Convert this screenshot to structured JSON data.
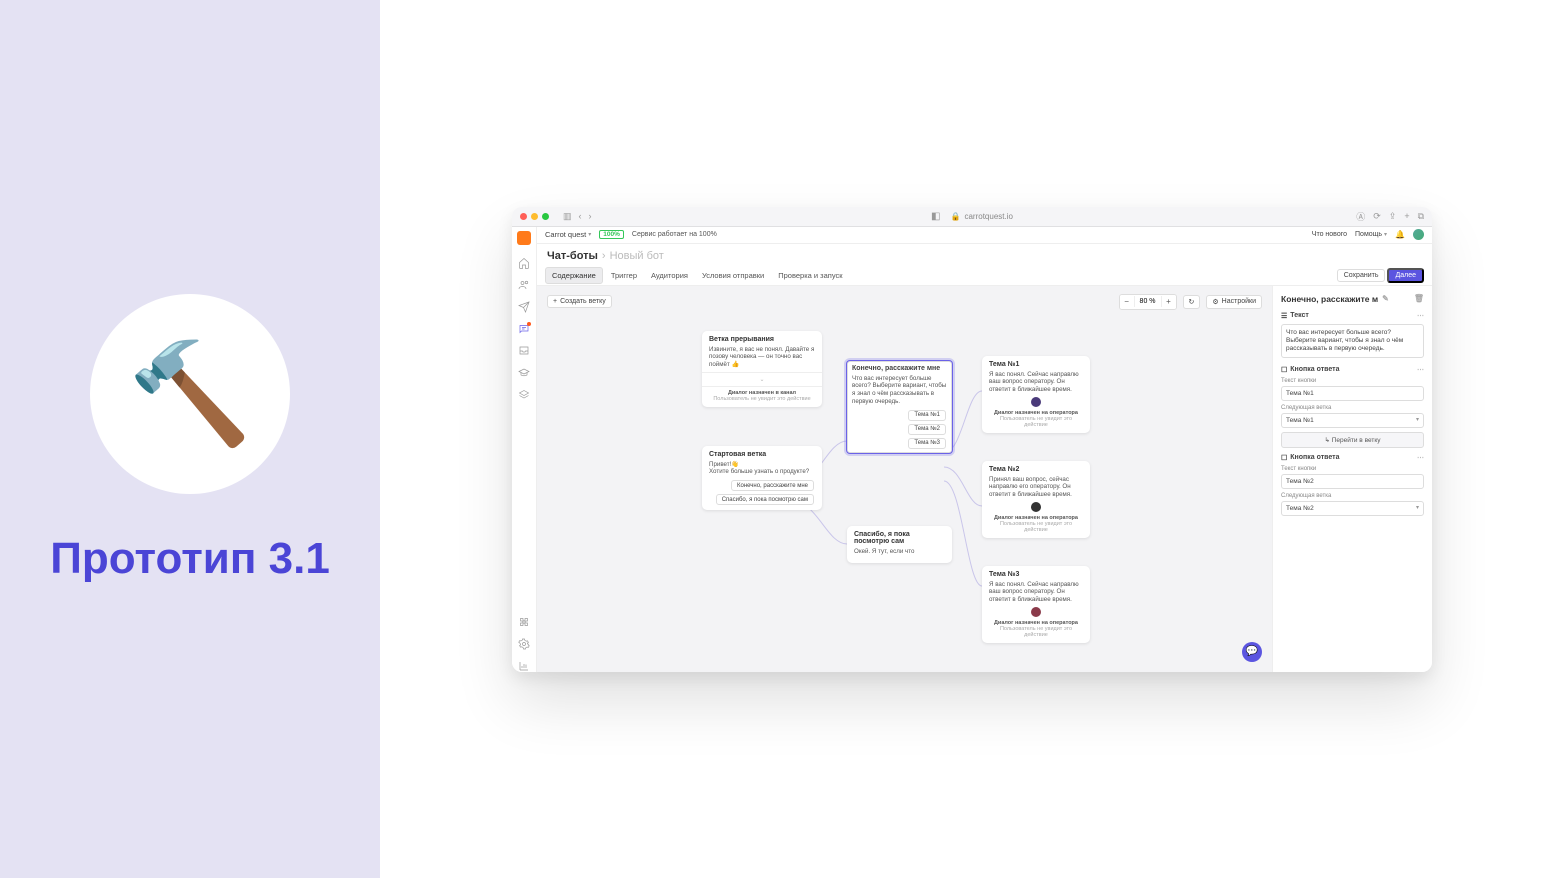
{
  "left": {
    "hammer": "🔨",
    "title": "Прототип 3.1"
  },
  "browser": {
    "url": "carrotquest.io",
    "lock": "🔒"
  },
  "topbar": {
    "account": "Carrot quest",
    "badge": "100%",
    "status": "Сервис работает на 100%",
    "whats_new": "Что нового",
    "help": "Помощь"
  },
  "crumb": {
    "root": "Чат-боты",
    "sep": "›",
    "current": "Новый бот"
  },
  "tabs": {
    "content": "Содержание",
    "trigger": "Триггер",
    "audience": "Аудитория",
    "conditions": "Условия отправки",
    "launch": "Проверка и запуск"
  },
  "actions": {
    "save": "Сохранить",
    "next": "Далее"
  },
  "canvas": {
    "create": "Создать ветку",
    "zoom": "80 %",
    "reload": "↻",
    "settings": "Настройки"
  },
  "nodes": {
    "break": {
      "title": "Ветка прерывания",
      "body": "Извините, я вас не понял. Давайте я позову человека — он точно вас поймёт 👍",
      "meta_b": "Диалог назначен в канал",
      "meta_s": "Пользователь не увидит это действие"
    },
    "start": {
      "title": "Стартовая ветка",
      "body": "Привет!👋\nХотите больше узнать о продукте?",
      "btn1": "Конечно, расскажите мне",
      "btn2": "Спасибо, я пока посмотрю сам"
    },
    "tell": {
      "title": "Конечно, расскажите мне",
      "body": "Что вас интересует больше всего? Выберите вариант, чтобы я знал о чём рассказывать в первую очередь.",
      "btn1": "Тема №1",
      "btn2": "Тема №2",
      "btn3": "Тема №3"
    },
    "thanks": {
      "title": "Спасибо, я пока посмотрю сам",
      "body": "Окей. Я тут, если что"
    },
    "t1": {
      "title": "Тема №1",
      "body": "Я вас понял. Сейчас направлю ваш вопрос оператору. Он ответит в ближайшее время.",
      "meta_b": "Диалог назначен на оператора",
      "meta_s": "Пользователь не увидит это действие"
    },
    "t2": {
      "title": "Тема №2",
      "body": "Принял ваш вопрос, сейчас направлю его оператору. Он ответит в ближайшее время.",
      "meta_b": "Диалог назначен на оператора",
      "meta_s": "Пользователь не увидит это действие"
    },
    "t3": {
      "title": "Тема №3",
      "body": "Я вас понял. Сейчас направлю ваш вопрос оператору. Он ответит в ближайшее время.",
      "meta_b": "Диалог назначен на оператора",
      "meta_s": "Пользователь не увидит это действие"
    }
  },
  "inspector": {
    "title": "Конечно, расскажите м",
    "sec_text": "Текст",
    "text_value": "Что вас интересует больше всего? Выберите вариант, чтобы я знал о чём рассказывать в первую очередь.",
    "sec_btn": "Кнопка ответа",
    "lbl_btn_text": "Текст кнопки",
    "lbl_next": "Следующая ветка",
    "btn1": {
      "text": "Тема №1",
      "next": "Тема №1"
    },
    "goto": "Перейти в ветку",
    "btn2": {
      "text": "Тема №2",
      "next": "Тема №2"
    }
  }
}
